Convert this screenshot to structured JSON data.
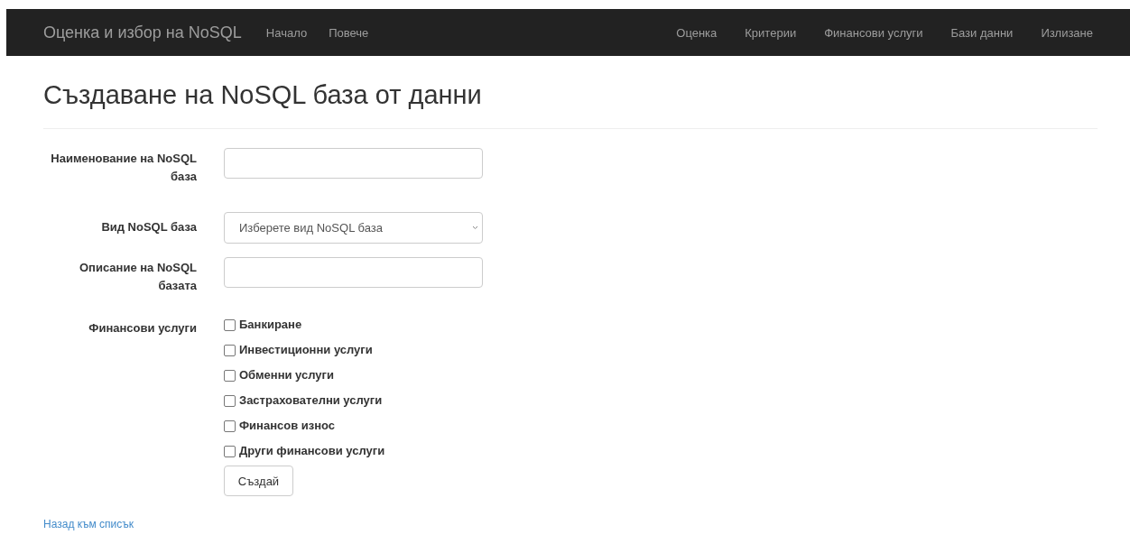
{
  "navbar": {
    "brand": "Оценка и избор на NoSQL",
    "left_links": [
      "Начало",
      "Повече"
    ],
    "right_links": [
      "Оценка",
      "Критерии",
      "Финансови услуги",
      "Бази данни",
      "Излизане"
    ]
  },
  "page_title": "Създаване на NoSQL база от данни",
  "form": {
    "fields": [
      {
        "kind": "text",
        "label": "Наименование на NoSQL база"
      },
      {
        "kind": "select",
        "label": "Вид NoSQL база",
        "value": "Изберете вид NoSQL база"
      },
      {
        "kind": "text",
        "label": "Описание на NoSQL базата"
      }
    ],
    "services": {
      "label": "Финансови услуги",
      "options": [
        {
          "label": "Банкиране",
          "checked": false
        },
        {
          "label": "Инвестиционни услуги",
          "checked": false
        },
        {
          "label": "Обменни услуги",
          "checked": false
        },
        {
          "label": "Застрахователни услуги",
          "checked": false
        },
        {
          "label": "Финансов износ",
          "checked": false
        },
        {
          "label": "Други финансови услуги",
          "checked": false
        }
      ]
    },
    "submit": "Създай"
  },
  "back_link": "Назад към списък"
}
